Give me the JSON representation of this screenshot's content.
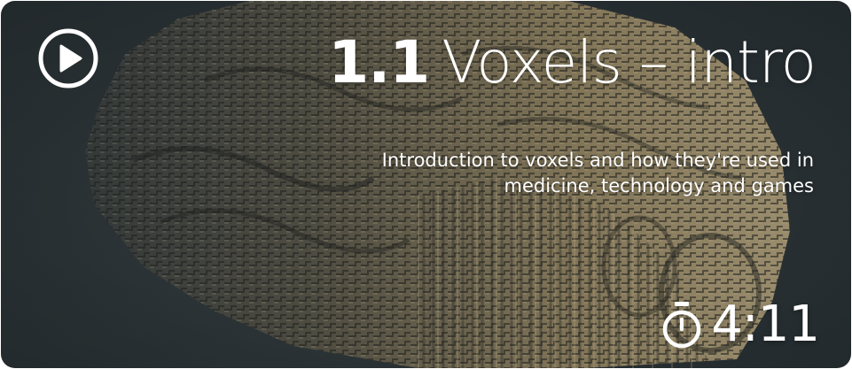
{
  "card": {
    "title_number": "1.1",
    "title_text": "Voxels – intro",
    "subtitle": "Introduction to voxels and how they're used in medicine, technology and games",
    "duration": "4:11",
    "icons": {
      "play": "play-circle-icon",
      "timer": "stopwatch-icon"
    },
    "colors": {
      "text": "#ffffff",
      "background": "#2b3336",
      "voxel_light": "#b5a27a",
      "voxel_dark": "#3b3a30"
    }
  }
}
